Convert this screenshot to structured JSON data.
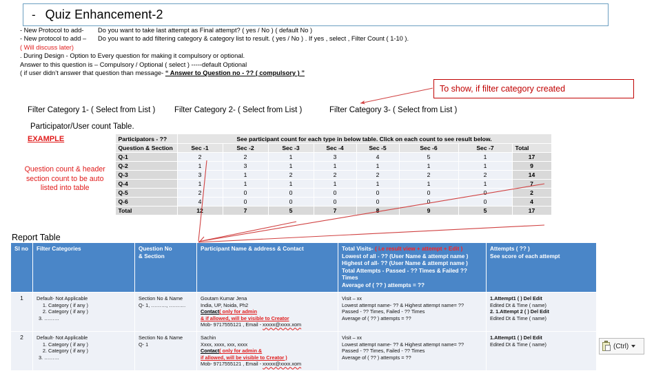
{
  "title": {
    "dash": "-",
    "text": "Quiz Enhancement-2"
  },
  "notes": {
    "line1_label": "- New Protocol to add-",
    "line1_text": "Do you want to take last attempt  as Final attempt? ( yes / No ) ( default No )",
    "line2_label": "- New protocol to add –",
    "line2_text": "Do you want to  add filtering category & category list to result. ( yes / No ) . If yes , select , Filter Count ( 1-10 ).",
    "line3_red": "( Will discuss later)",
    "line4": ". During Design - Option to Every question for making it compulsory or optional.",
    "line5": "Answer to this question is – Compulsory / Optional ( select ) -----default Optional",
    "line6_pre": "( if user didn’t answer that question than message-",
    "line6_quote": "“ Answer to Question no - ?? (  compulsory ) ”"
  },
  "callout": {
    "text": "To show, if filter category created"
  },
  "filters": {
    "f1": "Filter Category 1-  ( Select from List )",
    "f2": "Filter Category 2-  ( Select from List )",
    "f3": "Filter Category 3-  ( Select from List )"
  },
  "participator_title": "Participator/User count Table.",
  "count_table": {
    "example_label": "EXAMPLE",
    "left_note": "Question count & header section count to be auto listed into table",
    "participators_label": "Participators - ??",
    "instruction": "See participant count for each type in below table. Click on each count to see result below.",
    "columns": [
      "Question & Section",
      "Sec -1",
      "Sec -2",
      "Sec -3",
      "Sec -4",
      "Sec -5",
      "Sec -6",
      "Sec -7",
      "Total"
    ],
    "rows": [
      {
        "label": "Q-1",
        "values": [
          2,
          2,
          1,
          3,
          4,
          5,
          1
        ],
        "total": 17
      },
      {
        "label": "Q-2",
        "values": [
          1,
          3,
          1,
          1,
          1,
          1,
          1
        ],
        "total": 9
      },
      {
        "label": "Q-3",
        "values": [
          3,
          1,
          2,
          2,
          2,
          2,
          2
        ],
        "total": 14
      },
      {
        "label": "Q-4",
        "values": [
          1,
          1,
          1,
          1,
          1,
          1,
          1
        ],
        "total": 7
      },
      {
        "label": "Q-5",
        "values": [
          2,
          0,
          0,
          0,
          0,
          0,
          0
        ],
        "total": 2
      },
      {
        "label": "Q-6",
        "values": [
          4,
          0,
          0,
          0,
          0,
          0,
          0
        ],
        "total": 4
      }
    ],
    "total_row": {
      "label": "Total",
      "values": [
        12,
        7,
        5,
        7,
        8,
        9,
        5
      ],
      "total": 17
    }
  },
  "report": {
    "title": "Report Table",
    "headers": {
      "slno": "Sl no",
      "filter_categories": "Filter Categories",
      "question_no": "Question No\n& Section",
      "participant": "Participant Name & address  & Contact",
      "total_visits_black": "Total Visits-",
      "total_visits_red": "( i.e result view + attempt + Edit )",
      "visits_l2": "Lowest of all - ?? (User  Name & attempt name )",
      "visits_l3": "Highest of all- ?? (User  Name & attempt name )",
      "visits_l4": "Total  Attempts - Passed  - ?? Times & Failed ?? Times",
      "visits_l5": "Average of  ( ?? ) attempts = ??",
      "attempts_l1": "Attempts ( ?? )",
      "attempts_l2": "See score of each attempt"
    },
    "rows": [
      {
        "slno": "1",
        "cat_default": "Default- Not Applicable",
        "cat_items": [
          "Category ( if any )",
          "Category ( if any )"
        ],
        "cat_last": "3. ………",
        "question_l1": "Section No &  Name",
        "question_l2": "Q- 1, ………, ……….",
        "p_name": "Goutam Kumar Jena",
        "p_addr": "India, UP, Noida, Ph2",
        "p_contact_black": "Contact",
        "p_contact_red": "( only for admin",
        "p_contact_red2": "& if allowed,  will be visible to Creator",
        "p_mob": "Mob- 9717555121 , Email -  ",
        "p_email": "xxxxx@xxxx.xom",
        "v_l1": "Visit – xx",
        "v_l2": "Lowest  attempt name- ?? & Highest  attempt name= ??",
        "v_l3": "Passed - ?? Times, Failed - ?? Times",
        "v_l4": "Average of  ( ?? )  attempts = ??",
        "a_l1": "1.Attempt1  (  )  Del   Edit",
        "a_l2": "Edited  Dt & Time ( name)",
        "a_l3": "2. 1.Attempt 2  (  )  Del   Edit",
        "a_l4": "Edited  Dt & Time ( name)"
      },
      {
        "slno": "2",
        "cat_default": "Default- Not Applicable",
        "cat_items": [
          "Category ( if any )",
          "Category ( if any )"
        ],
        "cat_last": "3. ………",
        "question_l1": "Section No &  Name",
        "question_l2": "Q- 1",
        "p_name": "Sachin",
        "p_addr": "Xxxx, xxxx, xxx, xxxx",
        "p_contact_black": "Contact",
        "p_contact_red": "( only for admin &",
        "p_contact_red2": "if allowed,  will be visible to Creator  )",
        "p_mob": "Mob- 9717555121 , Email -  ",
        "p_email": "xxxxx@xxxx.xom",
        "v_l1": "Visit – xx",
        "v_l2": "Lowest  attempt name- ?? & Highest  attempt name= ??",
        "v_l3": "Passed - ?? Times, Failed - ?? Times",
        "v_l4": "Average of  ( ?? )  attempts = ??",
        "a_l1": "1.Attempt1  (  )  Del   Edit",
        "a_l2": "Edited  Dt & Time ( name)",
        "a_l3": "",
        "a_l4": ""
      }
    ]
  },
  "paste_button": {
    "label": "(Ctrl)",
    "icon": "clipboard-icon"
  },
  "colors": {
    "header_blue": "#4a86c8",
    "accent_red": "#e01b1b",
    "callout_red": "#c00000",
    "cell_blue": "#eef1f7",
    "cell_grey": "#d9d9d9"
  }
}
